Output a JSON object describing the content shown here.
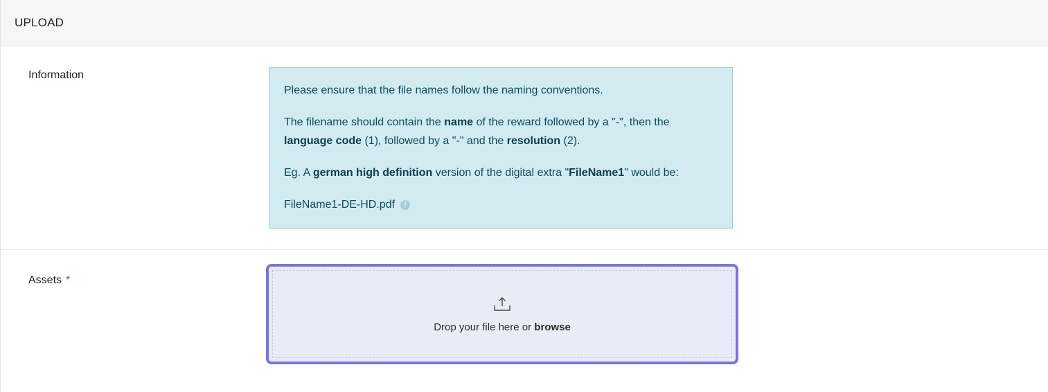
{
  "header": {
    "title": "UPLOAD"
  },
  "information": {
    "label": "Information",
    "line1": "Please ensure that the file names follow the naming conventions.",
    "line2_part1": "The filename should contain the ",
    "line2_bold1": "name",
    "line2_part2": " of the reward followed by a \"-\", then the ",
    "line2_bold2": "language code",
    "line2_part3": " (1), followed by a \"-\" and the ",
    "line2_bold3": "resolution",
    "line2_part4": " (2).",
    "line3_part1": "Eg. A ",
    "line3_bold1": "german high definition",
    "line3_part2": " version of the digital extra \"",
    "line3_bold2": "FileName1",
    "line3_part3": "\" would be:",
    "example_filename": "FileName1-DE-HD.pdf",
    "info_icon_glyph": "i"
  },
  "assets": {
    "label": "Assets",
    "required_mark": "*",
    "drop_text": "Drop your file here or ",
    "browse_text": "browse",
    "upload_icon": "upload-icon"
  },
  "colors": {
    "info_bg": "#d1ebf0",
    "info_border": "#9fd0d9",
    "dropzone_border": "#7a72e6",
    "dropzone_bg": "#ebebf7",
    "required": "#d9383a"
  }
}
